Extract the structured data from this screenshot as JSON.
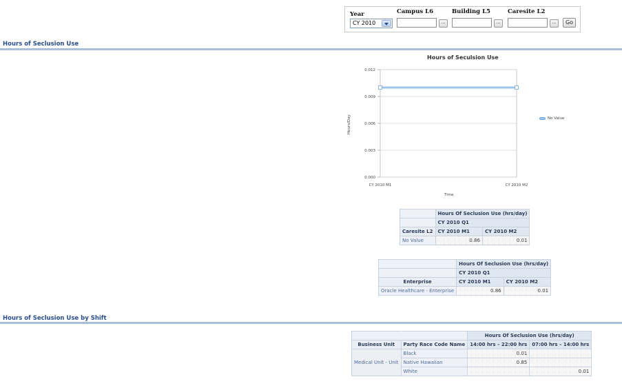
{
  "prompts": {
    "year": {
      "label": "Year",
      "value": "CY 2010"
    },
    "campus": {
      "label": "Campus L6",
      "value": ""
    },
    "building": {
      "label": "Building L5",
      "value": ""
    },
    "caresite": {
      "label": "Caresite L2",
      "value": ""
    },
    "browse_label": "...",
    "go_label": "Go"
  },
  "section1": {
    "title": "Hours of Seclusion Use"
  },
  "section2": {
    "title": "Hours of Seclusion Use by Shift"
  },
  "chart_data": {
    "type": "line",
    "title": "Hours of Seculsion Use",
    "xlabel": "Time",
    "ylabel": "Hours/Day",
    "categories": [
      "CY 2010 M1",
      "CY 2010 M2"
    ],
    "y_ticks": [
      "0.012",
      "0.009",
      "0.006",
      "0.003",
      "0.000"
    ],
    "ylim": [
      0,
      0.012
    ],
    "series": [
      {
        "name": "No Value",
        "values": [
          0.01,
          0.01
        ],
        "color": "#9cc5ee"
      }
    ],
    "legend_position": "right",
    "grid": true
  },
  "table1": {
    "measure": "Hours Of Seclusion Use (hrs/day)",
    "quarter": "CY 2010 Q1",
    "row_header": "Caresite L2",
    "columns": [
      "CY 2010 M1",
      "CY 2010 M2"
    ],
    "rows": [
      {
        "label": "No Value",
        "values": [
          "0.86",
          "0.01"
        ]
      }
    ]
  },
  "table2": {
    "measure": "Hours Of Seclusion Use (hrs/day)",
    "quarter": "CY 2010 Q1",
    "row_header": "Enterprise",
    "columns": [
      "CY 2010 M1",
      "CY 2010 M2"
    ],
    "rows": [
      {
        "label": "Oracle Healthcare - Enterprise",
        "values": [
          "0.86",
          "0.01"
        ]
      }
    ]
  },
  "table3": {
    "measure": "Hours Of Seclusion Use (hrs/day)",
    "row_headers": [
      "Business Unit",
      "Party Race Code Name"
    ],
    "columns": [
      "14:00 hrs – 22:00 hrs",
      "07:00 hrs – 14:00 hrs"
    ],
    "group": "Medical Unit - Unit",
    "rows": [
      {
        "label": "Black",
        "values": [
          "0.01",
          ""
        ]
      },
      {
        "label": "Native Hawaiian",
        "values": [
          "0.85",
          ""
        ]
      },
      {
        "label": "White",
        "values": [
          "",
          "0.01"
        ]
      }
    ]
  },
  "colors": {
    "accent": "#2a4d8f",
    "rule": "#a7bfd9",
    "series": "#9cc5ee"
  }
}
